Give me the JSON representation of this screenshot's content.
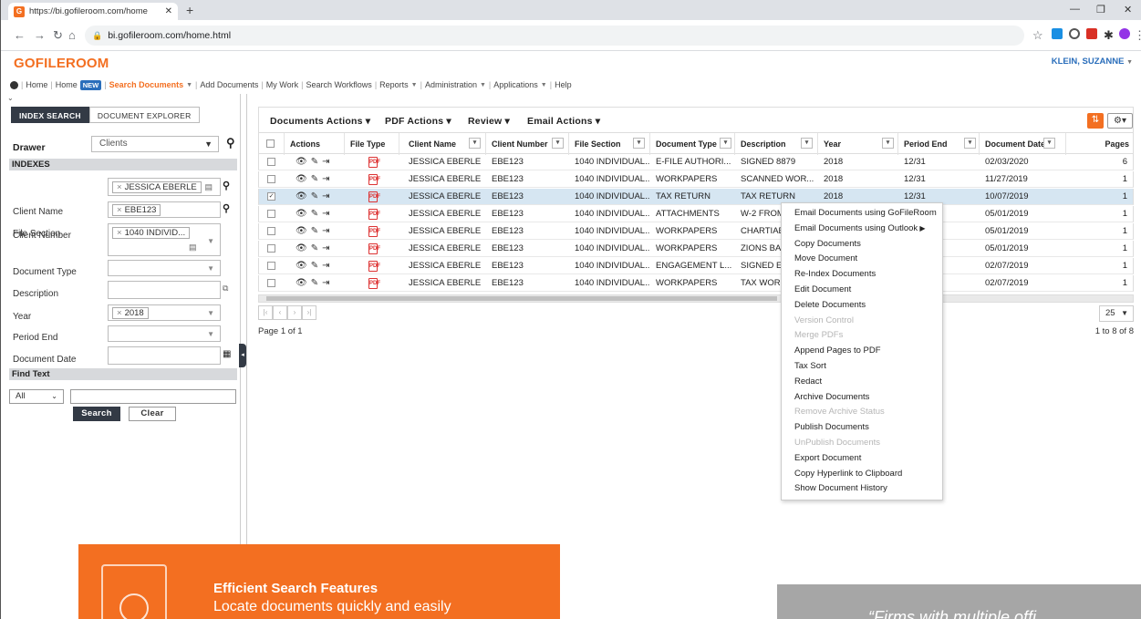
{
  "browser": {
    "tab_title": "https://bi.gofileroom.com/home",
    "url": "bi.gofileroom.com/home.html"
  },
  "app": {
    "logo": "GOFILEROOM",
    "user": "KLEIN, SUZANNE"
  },
  "menu": {
    "home": "Home",
    "home_new": "Home",
    "new_badge": "NEW",
    "search_documents": "Search Documents",
    "add_documents": "Add Documents",
    "my_work": "My Work",
    "search_workflows": "Search Workflows",
    "reports": "Reports",
    "administration": "Administration",
    "applications": "Applications",
    "help": "Help"
  },
  "left": {
    "tab_index": "INDEX SEARCH",
    "tab_explorer": "DOCUMENT EXPLORER",
    "drawer_label": "Drawer",
    "drawer_value": "Clients",
    "indexes_header": "INDEXES",
    "fields": {
      "client_name_label": "Client Name",
      "client_name_value": "JESSICA EBERLE",
      "client_number_label": "Client Number",
      "client_number_value": "EBE123",
      "file_section_label": "File Section",
      "file_section_value": "1040 INDIVID...",
      "document_type_label": "Document Type",
      "description_label": "Description",
      "year_label": "Year",
      "year_value": "2018",
      "period_end_label": "Period End",
      "document_date_label": "Document Date"
    },
    "find_text_header": "Find Text",
    "find_scope": "All",
    "search_btn": "Search",
    "clear_btn": "Clear"
  },
  "toolbar": {
    "documents_actions": "Documents Actions",
    "pdf_actions": "PDF Actions",
    "review": "Review",
    "email_actions": "Email Actions"
  },
  "columns": {
    "actions": "Actions",
    "file_type": "File Type",
    "client_name": "Client Name",
    "client_number": "Client Number",
    "file_section": "File Section",
    "document_type": "Document Type",
    "description": "Description",
    "year": "Year",
    "period_end": "Period End",
    "document_date": "Document Date",
    "pages": "Pages"
  },
  "rows": [
    {
      "client": "JESSICA EBERLE",
      "number": "EBE123",
      "section": "1040 INDIVIDUAL...",
      "type": "E-FILE AUTHORI...",
      "desc": "SIGNED 8879",
      "year": "2018",
      "period": "12/31",
      "date": "02/03/2020",
      "pages": "6",
      "checked": false
    },
    {
      "client": "JESSICA EBERLE",
      "number": "EBE123",
      "section": "1040 INDIVIDUAL...",
      "type": "WORKPAPERS",
      "desc": "SCANNED WOR...",
      "year": "2018",
      "period": "12/31",
      "date": "11/27/2019",
      "pages": "1",
      "checked": false
    },
    {
      "client": "JESSICA EBERLE",
      "number": "EBE123",
      "section": "1040 INDIVIDUAL...",
      "type": "TAX RETURN",
      "desc": "TAX RETURN",
      "year": "2018",
      "period": "12/31",
      "date": "10/07/2019",
      "pages": "1",
      "checked": true
    },
    {
      "client": "JESSICA EBERLE",
      "number": "EBE123",
      "section": "1040 INDIVIDUAL...",
      "type": "ATTACHMENTS",
      "desc": "W-2 FROM",
      "year": "",
      "period": "",
      "date": "05/01/2019",
      "pages": "1",
      "checked": false
    },
    {
      "client": "JESSICA EBERLE",
      "number": "EBE123",
      "section": "1040 INDIVIDUAL...",
      "type": "WORKPAPERS",
      "desc": "CHARTIAB",
      "year": "",
      "period": "",
      "date": "05/01/2019",
      "pages": "1",
      "checked": false
    },
    {
      "client": "JESSICA EBERLE",
      "number": "EBE123",
      "section": "1040 INDIVIDUAL...",
      "type": "WORKPAPERS",
      "desc": "ZIONS BAN",
      "year": "",
      "period": "",
      "date": "05/01/2019",
      "pages": "1",
      "checked": false
    },
    {
      "client": "JESSICA EBERLE",
      "number": "EBE123",
      "section": "1040 INDIVIDUAL...",
      "type": "ENGAGEMENT L...",
      "desc": "SIGNED EN",
      "year": "",
      "period": "",
      "date": "02/07/2019",
      "pages": "1",
      "checked": false
    },
    {
      "client": "JESSICA EBERLE",
      "number": "EBE123",
      "section": "1040 INDIVIDUAL...",
      "type": "WORKPAPERS",
      "desc": "TAX WORK",
      "year": "",
      "period": "",
      "date": "02/07/2019",
      "pages": "1",
      "checked": false
    }
  ],
  "pager": {
    "page_label": "Page 1 of 1",
    "per_page": "25",
    "count_label": "1 to 8 of 8"
  },
  "context_menu": [
    {
      "label": "Email Documents using GoFileRoom",
      "disabled": false,
      "submenu": false
    },
    {
      "label": "Email Documents using Outlook",
      "disabled": false,
      "submenu": true
    },
    {
      "label": "Copy Documents",
      "disabled": false,
      "submenu": false
    },
    {
      "label": "Move Document",
      "disabled": false,
      "submenu": false
    },
    {
      "label": "Re-Index Documents",
      "disabled": false,
      "submenu": false
    },
    {
      "label": "Edit Document",
      "disabled": false,
      "submenu": false
    },
    {
      "label": "Delete Documents",
      "disabled": false,
      "submenu": false
    },
    {
      "label": "Version Control",
      "disabled": true,
      "submenu": false
    },
    {
      "label": "Merge PDFs",
      "disabled": true,
      "submenu": false
    },
    {
      "label": "Append Pages to PDF",
      "disabled": false,
      "submenu": false
    },
    {
      "label": "Tax Sort",
      "disabled": false,
      "submenu": false
    },
    {
      "label": "Redact",
      "disabled": false,
      "submenu": false
    },
    {
      "label": "Archive Documents",
      "disabled": false,
      "submenu": false
    },
    {
      "label": "Remove Archive Status",
      "disabled": true,
      "submenu": false
    },
    {
      "label": "Publish Documents",
      "disabled": false,
      "submenu": false
    },
    {
      "label": "UnPublish Documents",
      "disabled": true,
      "submenu": false
    },
    {
      "label": "Export Document",
      "disabled": false,
      "submenu": false
    },
    {
      "label": "Copy Hyperlink to Clipboard",
      "disabled": false,
      "submenu": false
    },
    {
      "label": "Show Document History",
      "disabled": false,
      "submenu": false
    }
  ],
  "promo": {
    "title": "Efficient Search Features",
    "subtitle": "Locate documents quickly and easily"
  },
  "quote": {
    "text": "“Firms with multiple offi"
  },
  "colors": {
    "brand_orange": "#f36f21",
    "selection_blue": "#d6e6f2",
    "dark_button": "#333a45"
  }
}
